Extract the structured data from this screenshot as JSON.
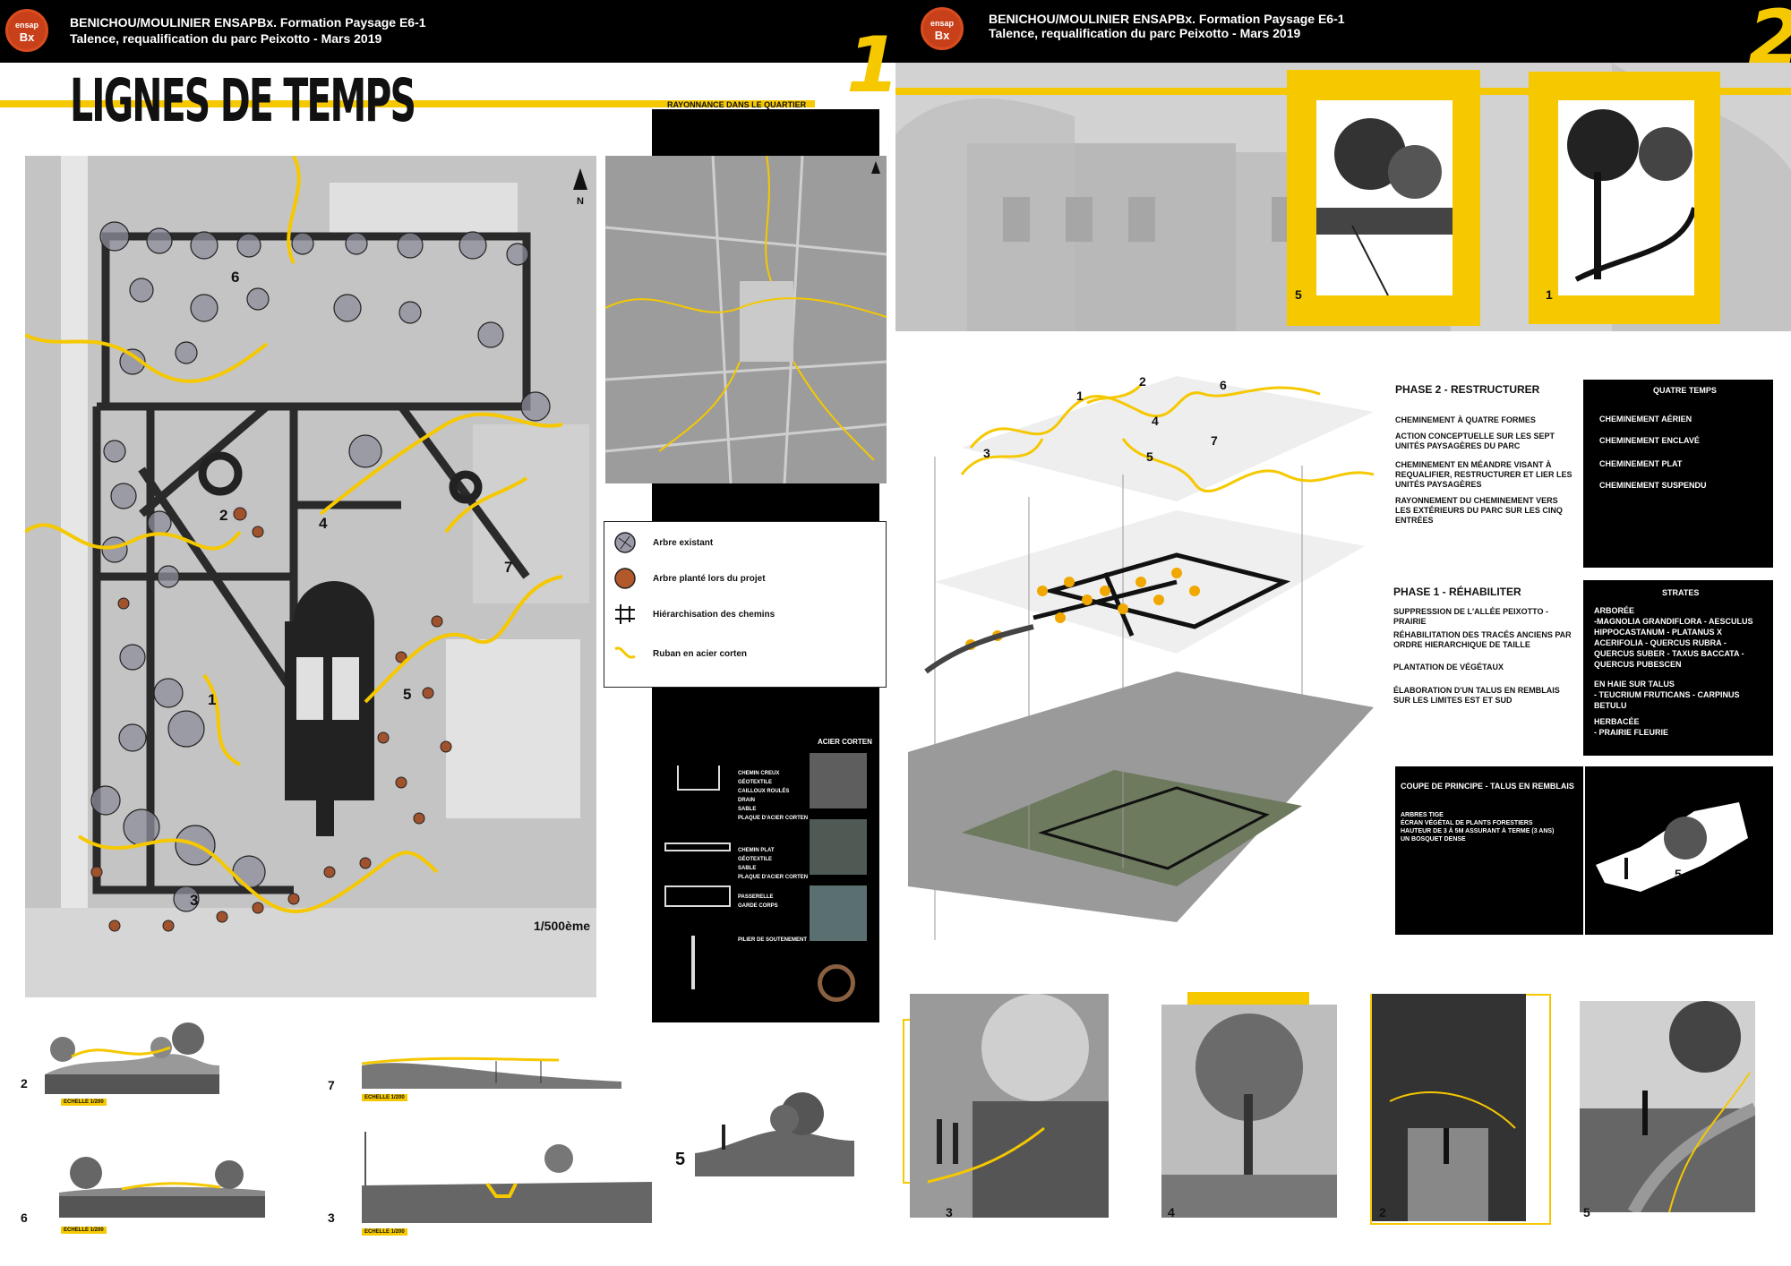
{
  "board1": {
    "header_line1": "BENICHOU/MOULINIER  ENSAPBx. Formation Paysage E6-1",
    "header_line2": "Talence, requalification du parc Peixotto - Mars 2019",
    "logo_top": "ensap",
    "logo_bottom": "Bx",
    "board_number": "1",
    "title": "LIGNES DE TEMPS",
    "rayonnance_label": "RAYONNANCE DANS LE QUARTIER",
    "map_numbers": [
      "1",
      "2",
      "3",
      "4",
      "5",
      "6",
      "7"
    ],
    "north": "N",
    "scale": "1/500ème",
    "legend": [
      {
        "icon": "existing-tree-icon",
        "label": "Arbre existant"
      },
      {
        "icon": "planted-tree-icon",
        "label": "Arbre planté lors du projet"
      },
      {
        "icon": "path-hierarchy-icon",
        "label": "Hiérarchisation des chemins"
      },
      {
        "icon": "corten-ribbon-icon",
        "label": "Ruban en acier corten"
      }
    ],
    "acier_corten": {
      "title": "ACIER CORTEN",
      "details": [
        [
          "CHEMIN CREUX",
          "GÉOTEXTILE",
          "CAILLOUX ROULÉS",
          "DRAIN",
          "SABLE",
          "PLAQUE D'ACIER CORTEN"
        ],
        [
          "CHEMIN PLAT",
          "GÉOTEXTILE",
          "SABLE",
          "PLAQUE D'ACIER CORTEN"
        ],
        [
          "PASSERELLE",
          "GARDE CORPS"
        ],
        [
          "PILIER DE SOUTENEMENT"
        ]
      ]
    },
    "sections": [
      {
        "num": "2",
        "scale": "ECHELLE 1/200"
      },
      {
        "num": "7",
        "scale": "ECHELLE 1/200"
      },
      {
        "num": "6",
        "scale": "ECHELLE 1/200"
      },
      {
        "num": "3",
        "scale": "ECHELLE 1/200"
      },
      {
        "num": "5",
        "scale": ""
      }
    ]
  },
  "board2": {
    "header_line1": "BENICHOU/MOULINIER  ENSAPBx. Formation Paysage E6-1",
    "header_line2": "Talence, requalification du parc Peixotto - Mars 2019",
    "logo_top": "ensap",
    "logo_bottom": "Bx",
    "board_number": "2",
    "banner_numbers": [
      "5",
      "1"
    ],
    "axo_numbers": [
      "1",
      "2",
      "6",
      "4",
      "3",
      "5",
      "7"
    ],
    "phase2_title": "PHASE 2 - RESTRUCTURER",
    "phase2_items": [
      "CHEMINEMENT À QUATRE FORMES",
      "ACTION CONCEPTUELLE SUR LES SEPT UNITÉS PAYSAGÈRES DU PARC",
      "CHEMINEMENT EN MÉANDRE VISANT À REQUALIFIER, RESTRUCTURER ET LIER LES UNITÉS PAYSAGÈRES",
      "RAYONNEMENT DU CHEMINEMENT VERS LES EXTÉRIEURS DU PARC SUR LES CINQ ENTRÉES"
    ],
    "quatre_temps_title": "QUATRE TEMPS",
    "quatre_temps_items": [
      "CHEMINEMENT AÉRIEN",
      "CHEMINEMENT ENCLAVÉ",
      "CHEMINEMENT PLAT",
      "CHEMINEMENT SUSPENDU"
    ],
    "phase1_title": "PHASE 1 - RÉHABILITER",
    "phase1_items": [
      "SUPPRESSION DE L'ALLÉE PEIXOTTO - PRAIRIE",
      "RÉHABILITATION DES TRACÉS ANCIENS PAR ORDRE HIERARCHIQUE DE TAILLE",
      "PLANTATION DE VÉGÉTAUX",
      "ÉLABORATION D'UN TALUS EN REMBLAIS SUR LES LIMITES EST ET SUD"
    ],
    "strates_title": "STRATES",
    "strates_items": [
      "ARBORÉE",
      "-MAGNOLIA GRANDIFLORA - AESCULUS HIPPOCASTANUM - PLATANUS X ACERIFOLIA - QUERCUS RUBRA - QUERCUS SUBER - TAXUS BACCATA - QUERCUS PUBESCEN",
      "EN HAIE SUR TALUS",
      "- TEUCRIUM FRUTICANS - CARPINUS BETULU",
      "HERBACÉE",
      "- PRAIRIE FLEURIE"
    ],
    "coupe_title": "COUPE DE PRINCIPE - TALUS EN REMBLAIS",
    "coupe_items": [
      "ARBRES TIGE",
      "ÉCRAN VÉGÉTAL DE PLANTS FORESTIERS",
      "HAUTEUR DE 3 À 5M ASSURANT À TERME  (3 ANS)",
      "UN BOSQUET DENSE"
    ],
    "coupe_number": "5",
    "photo_numbers": [
      "3",
      "4",
      "2",
      "5"
    ]
  },
  "colors": {
    "accent": "#f5c800",
    "black": "#000000",
    "logo": "#c8401a"
  }
}
